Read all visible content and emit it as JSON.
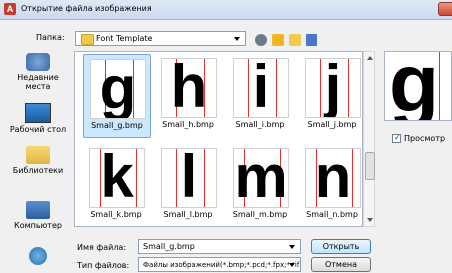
{
  "dialog": {
    "title": "Открытие файла изображения",
    "app_icon_letter": "A"
  },
  "toolbar": {
    "folder_label": "Папка:",
    "folder_value": "Font Template"
  },
  "places": [
    {
      "label": "Недавние места",
      "icon": "recent-places-icon"
    },
    {
      "label": "Рабочий стол",
      "icon": "desktop-icon"
    },
    {
      "label": "Библиотеки",
      "icon": "libraries-icon"
    },
    {
      "label": "Компьютер",
      "icon": "computer-icon"
    },
    {
      "label": "",
      "icon": "network-icon"
    }
  ],
  "files": [
    {
      "glyph": "g",
      "name": "Small_g.bmp",
      "selected": true
    },
    {
      "glyph": "h",
      "name": "Small_h.bmp"
    },
    {
      "glyph": "i",
      "name": "Small_i.bmp"
    },
    {
      "glyph": "j",
      "name": "Small_j.bmp"
    },
    {
      "glyph": "k",
      "name": "Small_k.bmp"
    },
    {
      "glyph": "l",
      "name": "Small_l.bmp"
    },
    {
      "glyph": "m",
      "name": "Small_m.bmp"
    },
    {
      "glyph": "n",
      "name": "Small_n.bmp"
    }
  ],
  "preview": {
    "glyph": "g",
    "checkbox_label": "Просмотр",
    "checked": true
  },
  "bottom": {
    "filename_label": "Имя файла:",
    "filename_value": "Small_g.bmp",
    "filetype_label": "Тип файлов:",
    "filetype_value": "Файлы изображений(*.bmp;*.pcd;*.fpx;*.tif;*.g",
    "open_label": "Открыть",
    "cancel_label": "Отмена"
  },
  "colors": {
    "selection": "#cce8ff",
    "guide_line": "#e03030"
  }
}
